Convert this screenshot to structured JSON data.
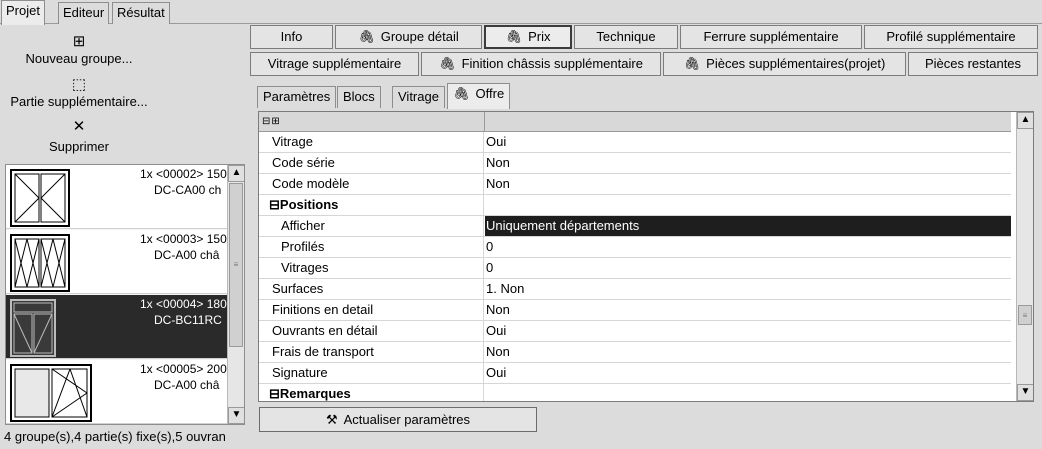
{
  "top_tabs": [
    "Projet",
    "Editeur",
    "Résultat"
  ],
  "tools": {
    "new_group": "Nouveau groupe...",
    "extra_part": "Partie supplémentaire...",
    "delete": "Supprimer"
  },
  "groups": [
    {
      "line1": "1x <00002> 150",
      "line2": "DC-CA00 ch"
    },
    {
      "line1": "1x <00003> 150",
      "line2": "DC-A00 châ"
    },
    {
      "line1": "1x <00004> 180",
      "line2": "DC-BC11RC"
    },
    {
      "line1": "1x <00005> 200",
      "line2": "DC-A00 châ"
    }
  ],
  "selected_group": 2,
  "status": "4 groupe(s),4 partie(s) fixe(s),5 ouvran",
  "buttons_row1": [
    "Info",
    "Groupe détail",
    "Prix",
    "Technique",
    "Ferrure supplémentaire",
    "Profilé supplémentaire"
  ],
  "buttons_row2": [
    "Vitrage supplémentaire",
    "Finition châssis supplémentaire",
    "Pièces supplémentaires(projet)",
    "Pièces restantes"
  ],
  "inner_tabs": [
    "Paramètres",
    "Blocs",
    "Vitrage",
    "Offre"
  ],
  "grid_rows": [
    {
      "name": "Vitrage",
      "value": "Oui"
    },
    {
      "name": "Code série",
      "value": "Non"
    },
    {
      "name": "Code modèle",
      "value": "Non"
    },
    {
      "name": "Positions",
      "value": ""
    },
    {
      "name": "Afficher",
      "value": "Uniquement départements"
    },
    {
      "name": "Profilés",
      "value": "0"
    },
    {
      "name": "Vitrages",
      "value": "0"
    },
    {
      "name": "Surfaces",
      "value": "1. Non"
    },
    {
      "name": "Finitions en detail",
      "value": "Non"
    },
    {
      "name": "Ouvrants en détail",
      "value": "Oui"
    },
    {
      "name": "Frais de transport",
      "value": "Non"
    },
    {
      "name": "Signature",
      "value": "Oui"
    },
    {
      "name": "Remarques",
      "value": ""
    }
  ],
  "refresh_button": "Actualiser paramètres"
}
